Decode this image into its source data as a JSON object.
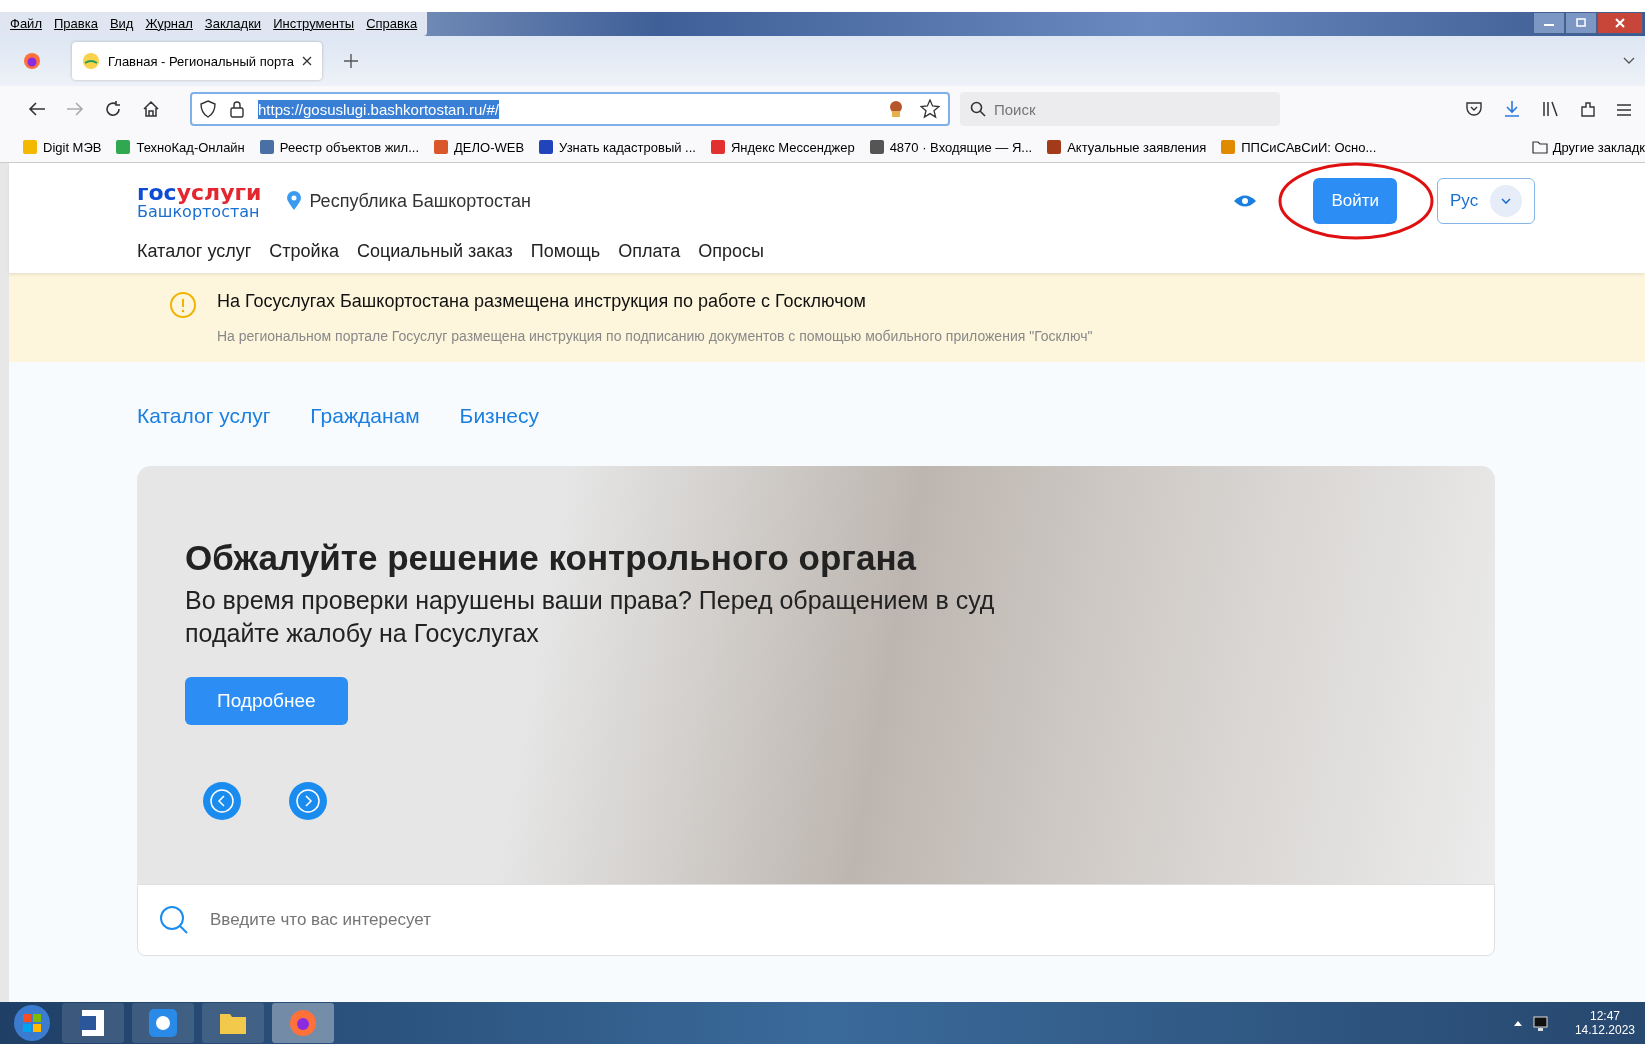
{
  "menu_bar": [
    "Файл",
    "Правка",
    "Вид",
    "Журнал",
    "Закладки",
    "Инструменты",
    "Справка"
  ],
  "tabs": [
    {
      "label": "Главная - Региональный порта",
      "selected": true
    }
  ],
  "address_bar": {
    "url": "https://gosuslugi.bashkortostan.ru/#/"
  },
  "browser_search": {
    "placeholder": "Поиск"
  },
  "bookmarks": [
    {
      "label": "Digit МЭВ"
    },
    {
      "label": "ТехноКад-Онлайн"
    },
    {
      "label": "Реестр объектов жил..."
    },
    {
      "label": "ДЕЛО-WEB"
    },
    {
      "label": "Узнать кадастровый ..."
    },
    {
      "label": "Яндекс Мессенджер"
    },
    {
      "label": "4870 · Входящие — Я..."
    },
    {
      "label": "Актуальные заявления"
    },
    {
      "label": "ППСиСАвСиИ: Осно..."
    }
  ],
  "other_bookmarks": "Другие закладк",
  "site_header": {
    "logo_primary": "гос",
    "logo_accent": "услуги",
    "logo_region": "Башкортостан",
    "region": "Республика Башкортостан",
    "login_button": "Войти",
    "language": "Рус"
  },
  "site_nav": [
    "Каталог услуг",
    "Стройка",
    "Социальный заказ",
    "Помощь",
    "Оплата",
    "Опросы"
  ],
  "notice": {
    "title": "На Госуслугах Башкортостана размещена инструкция по работе с Госключом",
    "text": "На региональном портале Госуслуг размещена инструкция по подписанию документов с помощью мобильного приложения \"Госключ\""
  },
  "section_tabs": [
    "Каталог услуг",
    "Гражданам",
    "Бизнесу"
  ],
  "hero": {
    "title": "Обжалуйте решение контрольного органа",
    "subtitle": "Во время проверки нарушены ваши права? Перед обращением в суд подайте жалобу на Госуслугах",
    "button": "Подробнее"
  },
  "site_search": {
    "placeholder": "Введите что вас интересует"
  },
  "clock": {
    "time": "12:47",
    "date": "14.12.2023"
  }
}
